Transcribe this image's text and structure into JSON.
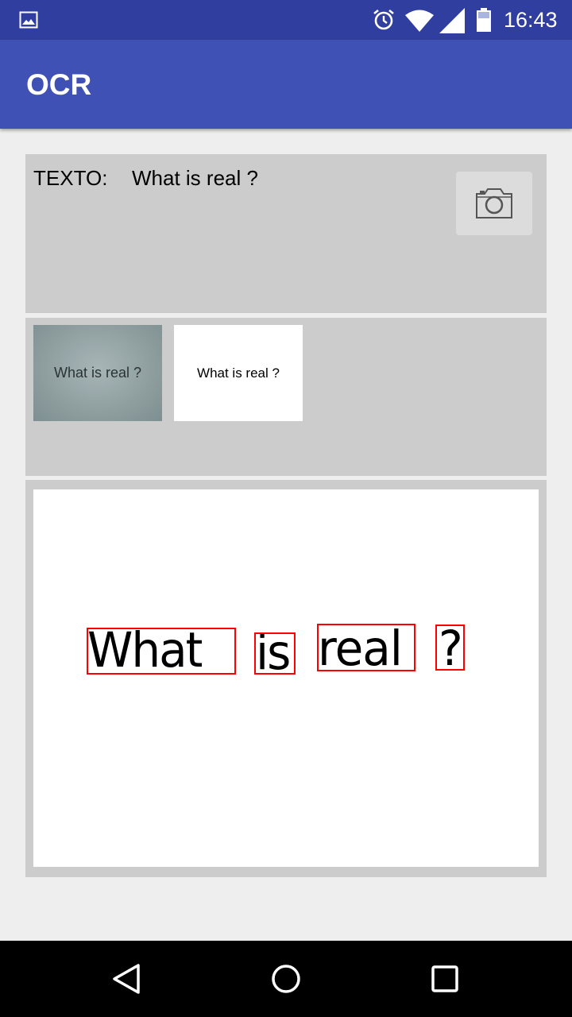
{
  "status_bar": {
    "time": "16:43",
    "icons": [
      "gallery-icon",
      "alarm-icon",
      "wifi-icon",
      "signal-icon",
      "battery-icon"
    ]
  },
  "app_bar": {
    "title": "OCR",
    "color": "#3f51b5",
    "status_color": "#303f9f"
  },
  "result": {
    "label": "TEXTO:",
    "value": "What is real ?",
    "camera_button_icon": "camera-icon"
  },
  "thumbnails": [
    {
      "kind": "original-photo",
      "text": "What is real ?"
    },
    {
      "kind": "binarized",
      "text": "What is real ?"
    }
  ],
  "detection": {
    "words": [
      "What",
      "is",
      "real",
      "?"
    ],
    "box_color": "#ff0000"
  },
  "nav_bar": {
    "icons": [
      "back-icon",
      "home-icon",
      "recents-icon"
    ]
  }
}
